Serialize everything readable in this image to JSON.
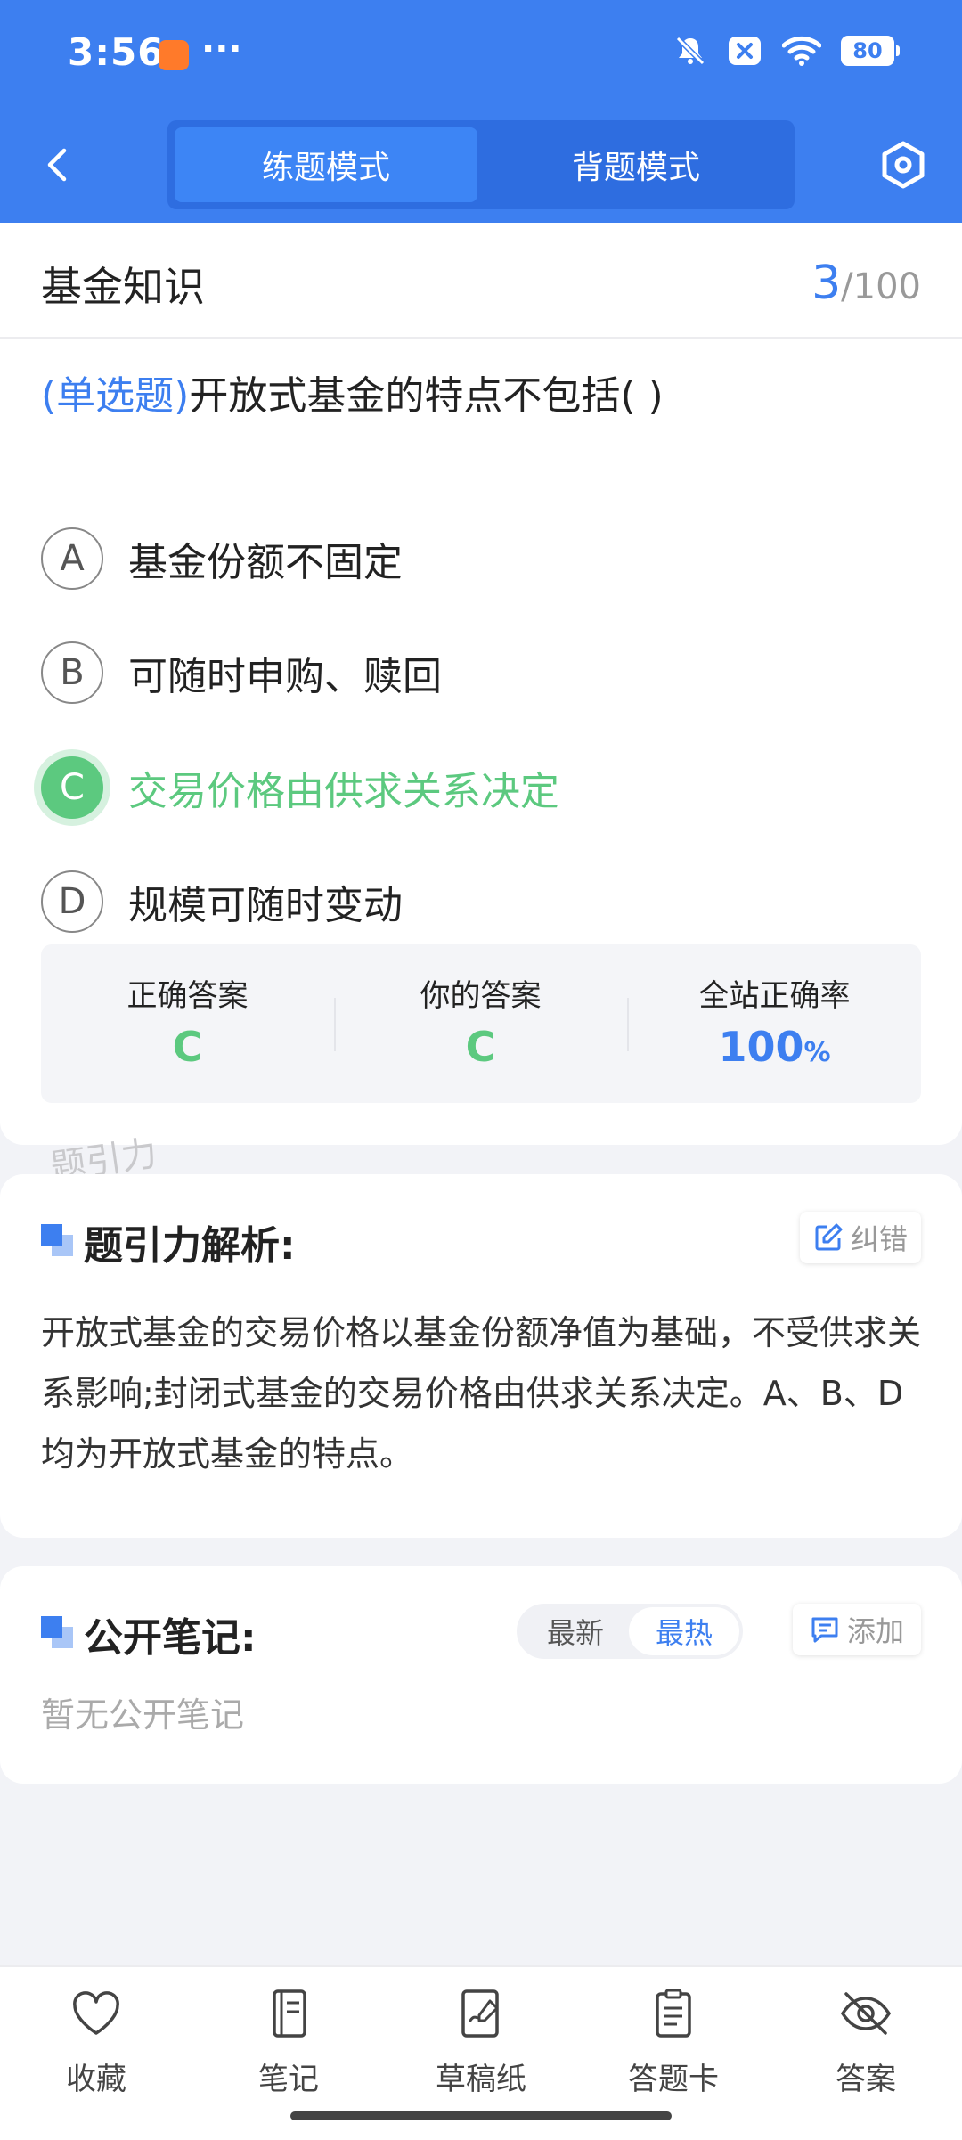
{
  "status_bar": {
    "time": "3:56",
    "more": "···",
    "battery": "80",
    "icons": [
      "mute-bell-icon",
      "close-badge-icon",
      "wifi-icon",
      "battery-icon"
    ]
  },
  "nav": {
    "tab_practice": "练题模式",
    "tab_memorize": "背题模式"
  },
  "question": {
    "subject": "基金知识",
    "current": "3",
    "separator": "/",
    "total": "100",
    "type_label": "(单选题)",
    "text": "开放式基金的特点不包括(        )",
    "options": [
      {
        "letter": "A",
        "text": "基金份额不固定"
      },
      {
        "letter": "B",
        "text": "可随时申购、赎回"
      },
      {
        "letter": "C",
        "text": "交易价格由供求关系决定"
      },
      {
        "letter": "D",
        "text": "规模可随时变动"
      }
    ],
    "correct_option": "C"
  },
  "stats": {
    "correct_label": "正确答案",
    "correct_value": "C",
    "yours_label": "你的答案",
    "yours_value": "C",
    "rate_label": "全站正确率",
    "rate_value": "100",
    "rate_unit": "%"
  },
  "watermark": "题引力",
  "analysis": {
    "title": "题引力解析:",
    "correction_label": "纠错",
    "body": "开放式基金的交易价格以基金份额净值为基础，不受供求关系影响;封闭式基金的交易价格由供求关系决定。A、B、D均为开放式基金的特点。"
  },
  "notes": {
    "title": "公开笔记:",
    "sort_latest": "最新",
    "sort_hot": "最热",
    "add_label": "添加",
    "empty_text": "暂无公开笔记"
  },
  "bottom_bar": {
    "items": [
      {
        "label": "收藏",
        "icon": "heart-icon"
      },
      {
        "label": "笔记",
        "icon": "notebook-icon"
      },
      {
        "label": "草稿纸",
        "icon": "draft-paper-icon"
      },
      {
        "label": "答题卡",
        "icon": "answer-card-icon"
      },
      {
        "label": "答案",
        "icon": "eye-off-icon"
      }
    ]
  },
  "colors": {
    "primary": "#3d7ff0",
    "correct": "#5cc97f",
    "background": "#f2f3f7"
  }
}
